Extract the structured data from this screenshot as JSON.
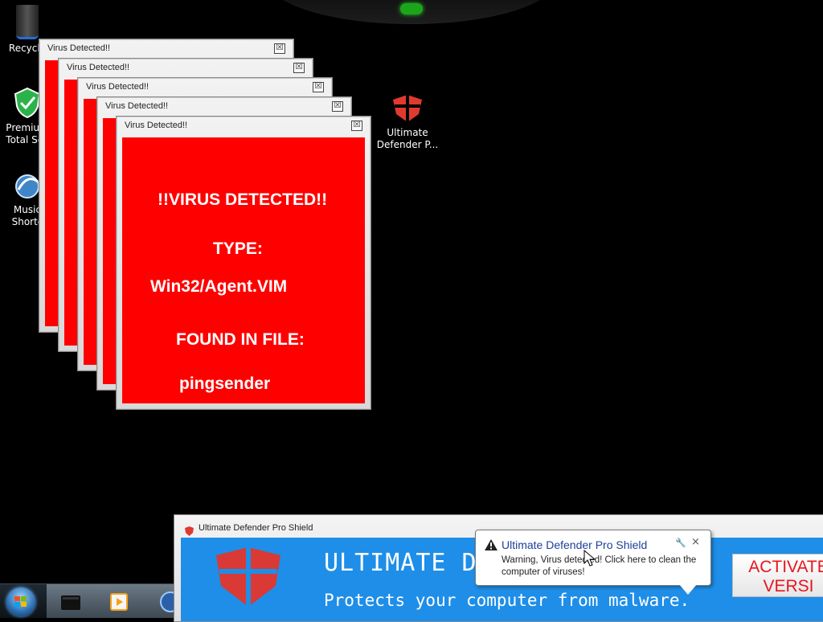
{
  "desktop": {
    "icons": [
      {
        "label": "Recycle",
        "icon": "recycle-bin-icon"
      },
      {
        "label": "Premium Total Sec",
        "line1": "Premium",
        "line2": "Total Sec",
        "icon": "shield-icon"
      },
      {
        "label": "Music Shortc",
        "line1": "Music",
        "line2": "Shortc",
        "icon": "music-shortcut-icon"
      },
      {
        "label": "Ultimate Defender P...",
        "line1": "Ultimate",
        "line2": "Defender P...",
        "icon": "ultimate-defender-icon"
      }
    ]
  },
  "popups": {
    "title": "Virus Detected!!",
    "close_glyph": "☒",
    "count": 5,
    "front": {
      "heading": "!!VIRUS DETECTED!!",
      "type_label": "TYPE:",
      "type_value": "Win32/Agent.VIM",
      "found_label": "FOUND IN FILE:",
      "found_value": "pingsender"
    }
  },
  "app_window": {
    "title": "Ultimate Defender Pro Shield",
    "headline": "ULTIMATE DEF",
    "tagline": "Protects your computer from malware.",
    "activate_line1": "ACTIVATE",
    "activate_line2": "VERSI"
  },
  "notification": {
    "title": "Ultimate Defender Pro Shield",
    "text": "Warning, Virus detected! Click here to clean the computer of viruses!",
    "close_glyph": "×",
    "wrench_glyph": "🔧"
  },
  "colors": {
    "alert_red": "#ff0000",
    "banner_blue": "#1e8ee8",
    "activate_red": "#e8141c",
    "link_blue": "#1c3f9a"
  }
}
